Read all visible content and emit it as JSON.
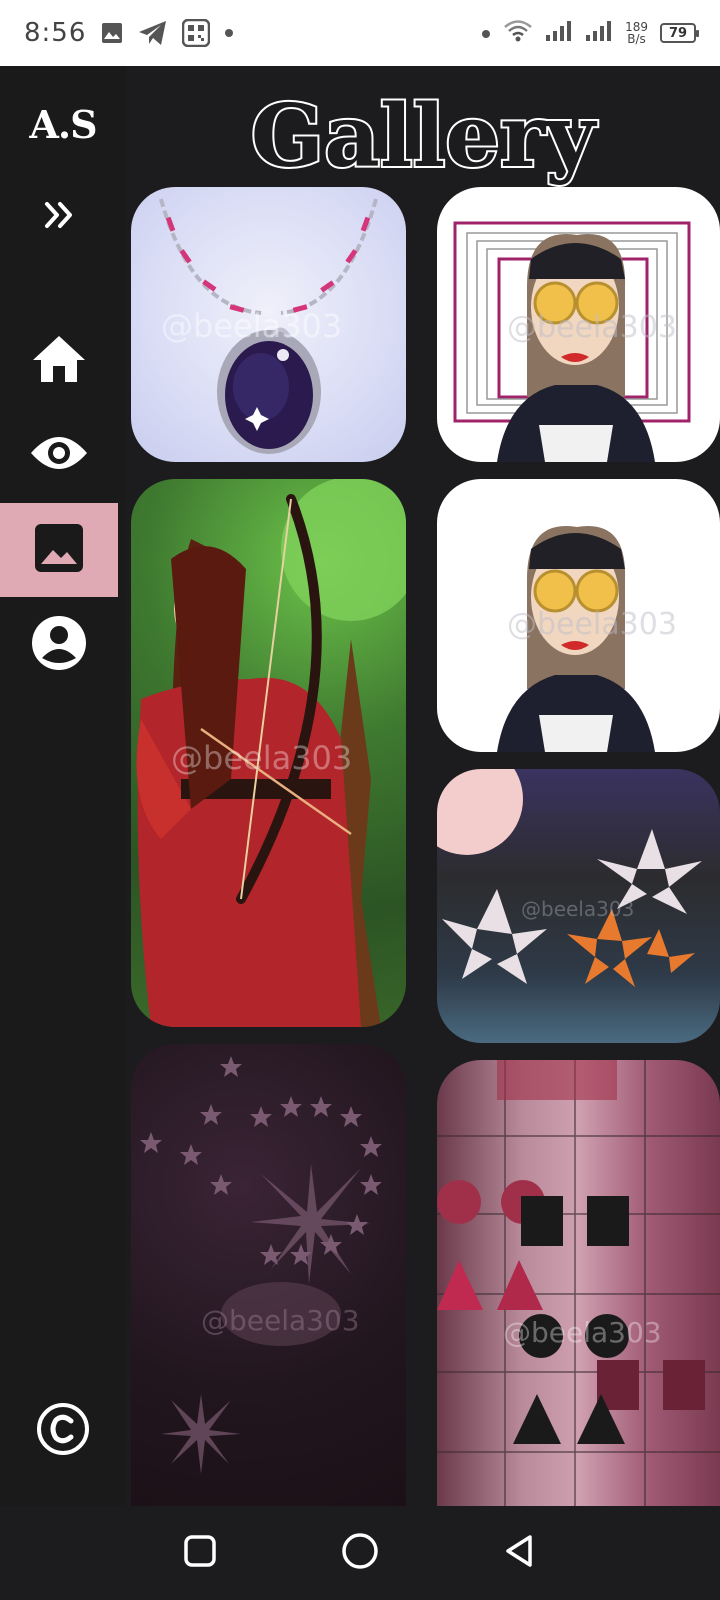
{
  "status_bar": {
    "time": "8:56",
    "speed_value": "189",
    "speed_unit": "B/s",
    "battery": "79",
    "icons": [
      "image-icon",
      "telegram-icon",
      "qr-icon",
      "dot-icon",
      "wifi-icon",
      "signal-icon",
      "signal-icon-2"
    ]
  },
  "sidebar": {
    "logo": "A.S",
    "items": [
      {
        "name": "expand",
        "icon": "double-chevron-right-icon"
      },
      {
        "name": "home",
        "icon": "home-icon"
      },
      {
        "name": "view",
        "icon": "eye-icon"
      },
      {
        "name": "gallery",
        "icon": "image-icon",
        "active": true
      },
      {
        "name": "profile",
        "icon": "account-circle-icon"
      }
    ],
    "copyright_icon": "copyright-icon",
    "active_color": "#e0aab4"
  },
  "page": {
    "title": "Gallery"
  },
  "gallery": {
    "watermark": "@beela303",
    "items": [
      {
        "name": "necklace",
        "description_icon": "artwork-image"
      },
      {
        "name": "portrait-frames",
        "description_icon": "artwork-image"
      },
      {
        "name": "archer",
        "description_icon": "artwork-image"
      },
      {
        "name": "portrait",
        "description_icon": "artwork-image"
      },
      {
        "name": "lilies-night",
        "description_icon": "artwork-image"
      },
      {
        "name": "starry-clouds",
        "description_icon": "artwork-image"
      },
      {
        "name": "geometric-shapes",
        "description_icon": "artwork-image"
      }
    ]
  },
  "nav_bar": {
    "buttons": [
      "recents-square-icon",
      "home-circle-icon",
      "back-triangle-icon"
    ]
  }
}
